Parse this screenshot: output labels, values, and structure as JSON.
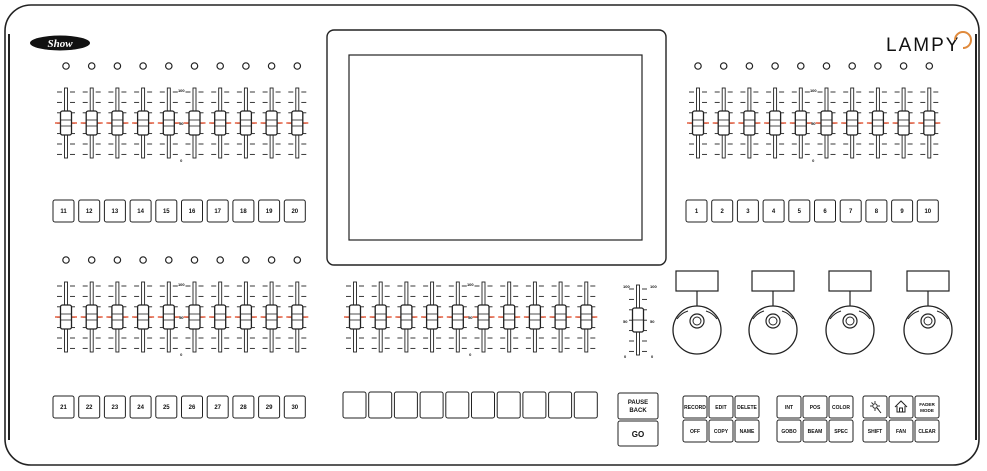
{
  "console": {
    "brand_logo_text": "Show",
    "model_name": "LAMPY",
    "colors": {
      "outline": "#222222",
      "fader_center": "#e0401c",
      "logo_arc": "#e08a3c",
      "background": "#ffffff"
    }
  },
  "fader_scale": {
    "max": "100",
    "mid": "50",
    "min": "0"
  },
  "top_left_bank": {
    "count": 10,
    "fader_levels": [
      0.5,
      0.5,
      0.5,
      0.5,
      0.5,
      0.5,
      0.5,
      0.5,
      0.5,
      0.5
    ],
    "buttons": [
      "11",
      "12",
      "13",
      "14",
      "15",
      "16",
      "17",
      "18",
      "19",
      "20"
    ]
  },
  "top_right_bank": {
    "count": 10,
    "fader_levels": [
      0.5,
      0.5,
      0.5,
      0.5,
      0.5,
      0.5,
      0.5,
      0.5,
      0.5,
      0.5
    ],
    "buttons": [
      "1",
      "2",
      "3",
      "4",
      "5",
      "6",
      "7",
      "8",
      "9",
      "10"
    ]
  },
  "bottom_left_bank": {
    "count": 10,
    "fader_levels": [
      0.5,
      0.5,
      0.5,
      0.5,
      0.5,
      0.5,
      0.5,
      0.5,
      0.5,
      0.5
    ],
    "buttons": [
      "21",
      "22",
      "23",
      "24",
      "25",
      "26",
      "27",
      "28",
      "29",
      "30"
    ]
  },
  "center_bank": {
    "count": 10,
    "fader_levels": [
      0.5,
      0.5,
      0.5,
      0.5,
      0.5,
      0.5,
      0.5,
      0.5,
      0.5,
      0.5
    ],
    "buttons": [
      "",
      "",
      "",
      "",
      "",
      "",
      "",
      "",
      "",
      ""
    ]
  },
  "grand_master": {
    "level": 0.5,
    "scale_top": "100",
    "scale_mid": "50",
    "scale_bottom": "0"
  },
  "playback": {
    "pause_back_line1": "PAUSE",
    "pause_back_line2": "BACK",
    "go": "GO"
  },
  "encoders": {
    "count": 4,
    "display_values": [
      "",
      "",
      "",
      ""
    ]
  },
  "keypad": {
    "row1": [
      "RECORD",
      "EDIT",
      "DELETE"
    ],
    "row2": [
      "OFF",
      "COPY",
      "NAME"
    ],
    "attr_row1": [
      "INT",
      "POS",
      "COLOR"
    ],
    "attr_row2": [
      "GOBO",
      "BEAM",
      "SPEC"
    ],
    "util_row1_icons": [
      "highlight-icon",
      "home-icon"
    ],
    "fader_mode_line1": "FADER",
    "fader_mode_line2": "MODE",
    "util_row2": [
      "SHIFT",
      "FAN",
      "CLEAR"
    ]
  }
}
